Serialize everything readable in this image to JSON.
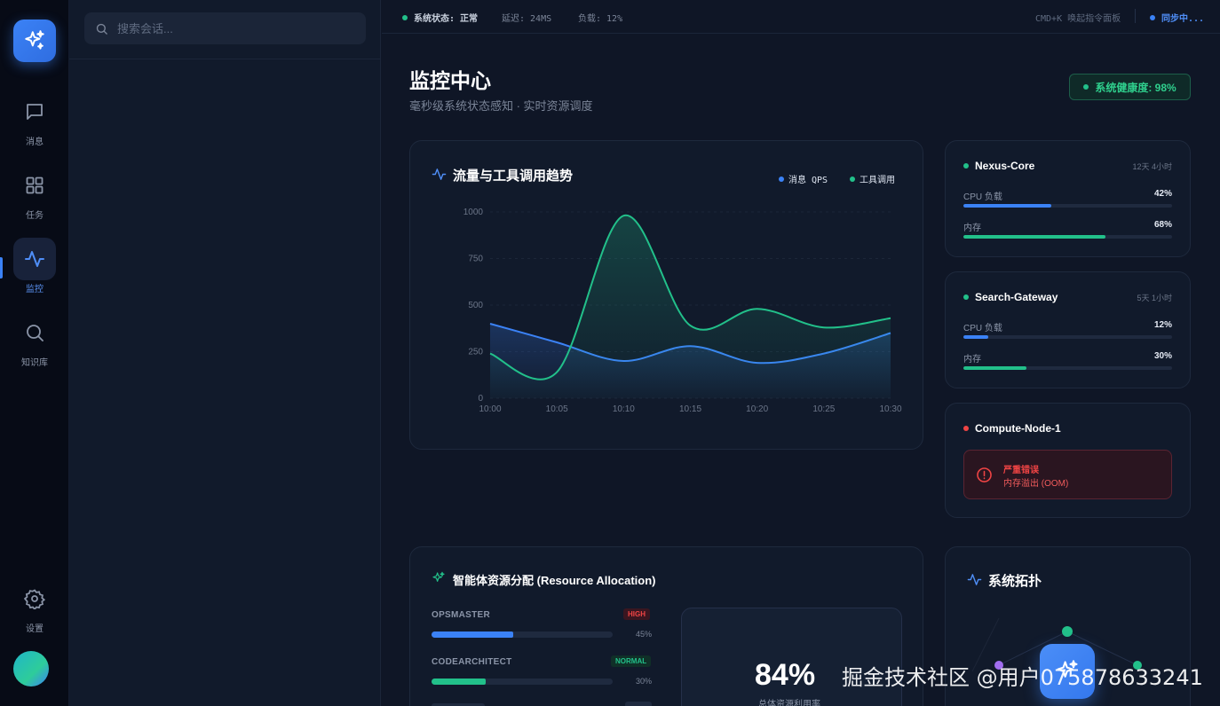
{
  "nav": {
    "items": [
      {
        "label": "消息",
        "icon": "message-icon"
      },
      {
        "label": "任务",
        "icon": "grid-icon"
      },
      {
        "label": "监控",
        "icon": "pulse-icon",
        "active": true
      },
      {
        "label": "知识库",
        "icon": "search-icon"
      }
    ],
    "settings_label": "设置"
  },
  "search": {
    "placeholder": "搜索会话..."
  },
  "topbar": {
    "status": "系统状态: 正常",
    "latency": "延迟: 24MS",
    "load": "负载: 12%",
    "shortcut": "CMD+K 唤起指令面板",
    "sync": "同步中..."
  },
  "page": {
    "title": "监控中心",
    "subtitle": "毫秒级系统状态感知 · 实时资源调度",
    "health": "系统健康度: 98%"
  },
  "traffic": {
    "title": "流量与工具调用趋势",
    "legend": [
      "消息 QPS",
      "工具调用"
    ]
  },
  "chart_data": {
    "type": "area",
    "title": "流量与工具调用趋势",
    "x": [
      "10:00",
      "10:05",
      "10:10",
      "10:15",
      "10:20",
      "10:25",
      "10:30"
    ],
    "yticks": [
      "1000",
      "750",
      "500",
      "250",
      "0"
    ],
    "ylim": [
      0,
      1000
    ],
    "grid": true,
    "legend_position": "top-right",
    "series": [
      {
        "name": "消息 QPS",
        "color": "#3b82f6",
        "values": [
          400,
          300,
          200,
          280,
          190,
          240,
          350
        ]
      },
      {
        "name": "工具调用",
        "color": "#22c08a",
        "values": [
          240,
          140,
          980,
          390,
          480,
          380,
          430
        ]
      }
    ]
  },
  "nodes": [
    {
      "name": "Nexus-Core",
      "uptime": "12天 4小时",
      "status_color": "#22c08a",
      "metrics": [
        {
          "label": "CPU 负载",
          "value": "42%",
          "fraction": 0.42,
          "color": "#3b82f6"
        },
        {
          "label": "内存",
          "value": "68%",
          "fraction": 0.68,
          "color": "#22c08a"
        }
      ]
    },
    {
      "name": "Search-Gateway",
      "uptime": "5天 1小时",
      "status_color": "#22c08a",
      "metrics": [
        {
          "label": "CPU 负载",
          "value": "12%",
          "fraction": 0.12,
          "color": "#3b82f6"
        },
        {
          "label": "内存",
          "value": "30%",
          "fraction": 0.3,
          "color": "#22c08a"
        }
      ]
    },
    {
      "name": "Compute-Node-1",
      "status_color": "#ef4444",
      "error_title": "严重错误",
      "error_detail": "内存溢出 (OOM)"
    }
  ],
  "resources": {
    "title": "智能体资源分配 (Resource Allocation)",
    "items": [
      {
        "name": "OPSMASTER",
        "badge": "HIGH",
        "pct": "45%",
        "fraction": 0.45,
        "color": "#3b82f6"
      },
      {
        "name": "CODEARCHITECT",
        "badge": "NORMAL",
        "pct": "30%",
        "fraction": 0.3,
        "color": "#22c08a"
      }
    ],
    "total": "84%",
    "total_label": "总体资源利用率"
  },
  "topology": {
    "title": "系统拓扑"
  },
  "watermark": "掘金技术社区 @用户0758786332​41"
}
